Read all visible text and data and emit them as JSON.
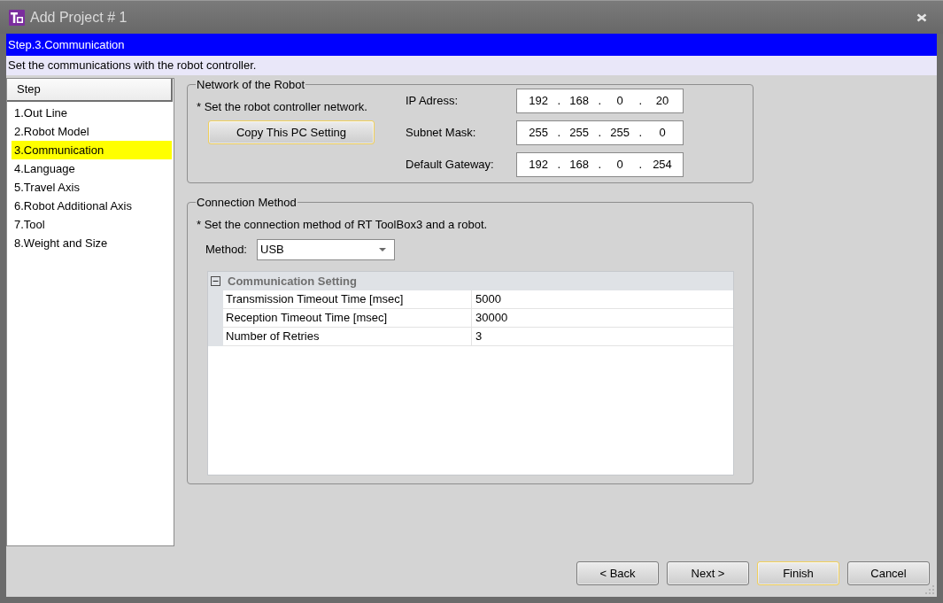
{
  "window": {
    "title": "Add Project # 1"
  },
  "step_header": {
    "title": "Step.3.Communication",
    "description": "Set the communications with the robot controller."
  },
  "steps": {
    "heading": "Step",
    "items": [
      {
        "label": "1.Out Line",
        "selected": false
      },
      {
        "label": "2.Robot Model",
        "selected": false
      },
      {
        "label": "3.Communication",
        "selected": true
      },
      {
        "label": "4.Language",
        "selected": false
      },
      {
        "label": "5.Travel Axis",
        "selected": false
      },
      {
        "label": "6.Robot Additional Axis",
        "selected": false
      },
      {
        "label": "7.Tool",
        "selected": false
      },
      {
        "label": "8.Weight and Size",
        "selected": false
      }
    ]
  },
  "network_group": {
    "title": "Network of the Robot",
    "note": "* Set the robot controller network.",
    "copy_button": {
      "label": "Copy This PC Setting",
      "focused": true
    },
    "fields": [
      {
        "label": "IP Adress:",
        "value": "192 . 168 . 0 . 20"
      },
      {
        "label": "Subnet Mask:",
        "value": "255 . 255 . 255 . 0"
      },
      {
        "label": "Default Gateway:",
        "value": "192 . 168 . 0 . 254"
      }
    ]
  },
  "connection_group": {
    "title": "Connection Method",
    "note": "* Set the connection method of RT ToolBox3 and a robot.",
    "method": {
      "label": "Method:",
      "value": "USB"
    },
    "settings": {
      "category": "Communication Setting",
      "expanded": true,
      "rows": [
        {
          "name": "Transmission Timeout Time [msec]",
          "value": "5000"
        },
        {
          "name": "Reception Timeout Time [msec]",
          "value": "30000"
        },
        {
          "name": "Number of Retries",
          "value": "3"
        }
      ]
    }
  },
  "buttons": [
    {
      "label": "< Back",
      "focused": false
    },
    {
      "label": "Next >",
      "focused": false
    },
    {
      "label": "Finish",
      "focused": true
    },
    {
      "label": "Cancel",
      "focused": false
    }
  ]
}
